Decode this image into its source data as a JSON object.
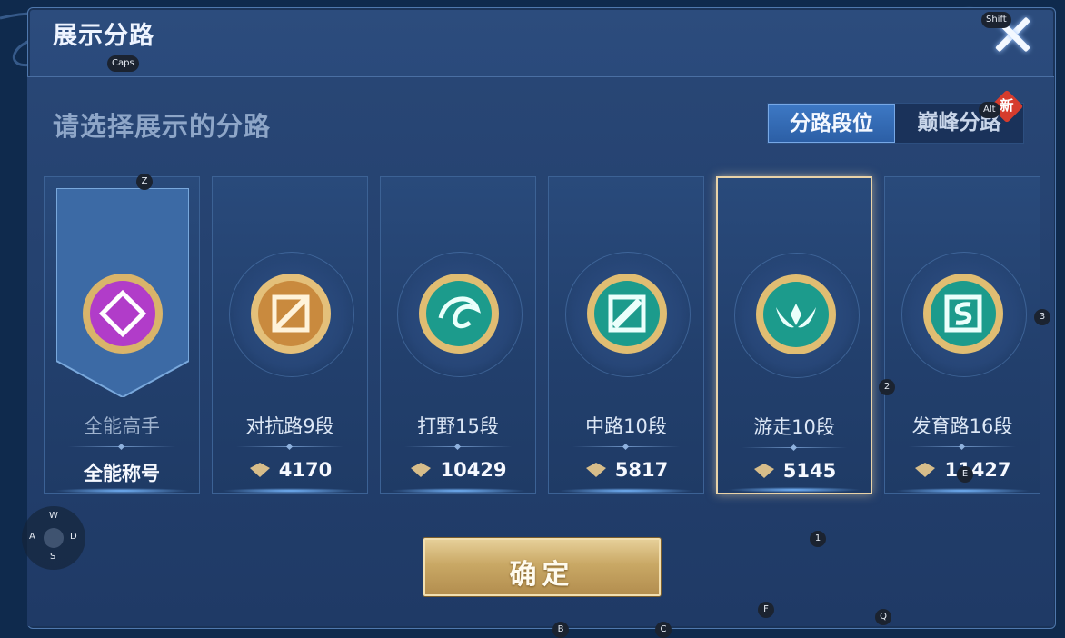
{
  "dialog": {
    "title": "展示分路",
    "subtitle": "请选择展示的分路",
    "close_icon": "close-x-icon"
  },
  "mode_toggle": {
    "active_label": "分路段位",
    "inactive_label": "巅峰分路",
    "new_badge": "新"
  },
  "lanes": [
    {
      "label": "全能高手",
      "value": "全能称号",
      "medal_color": "#b13cc9",
      "selected": false,
      "icon": "all-round-medal-icon"
    },
    {
      "label": "对抗路9段",
      "value": "4170",
      "medal_color": "#c98a3e",
      "selected": false,
      "icon": "sword-medal-icon"
    },
    {
      "label": "打野15段",
      "value": "10429",
      "medal_color": "#1c9b8c",
      "selected": false,
      "icon": "dragon-medal-icon"
    },
    {
      "label": "中路10段",
      "value": "5817",
      "medal_color": "#1c9b8c",
      "selected": false,
      "icon": "staff-medal-icon"
    },
    {
      "label": "游走10段",
      "value": "5145",
      "medal_color": "#1c9b8c",
      "selected": true,
      "icon": "wings-medal-icon"
    },
    {
      "label": "发育路16段",
      "value": "11427",
      "medal_color": "#1c9b8c",
      "selected": false,
      "icon": "arrow-medal-icon"
    }
  ],
  "confirm_button": "确定",
  "key_hints": {
    "shift": "Shift",
    "caps": "Caps",
    "alt": "Alt",
    "z": "Z",
    "num3": "3",
    "num2": "2",
    "num1": "1",
    "e": "E",
    "b": "B",
    "c": "C",
    "f": "F",
    "q": "Q",
    "w": "W",
    "a": "A",
    "s": "S",
    "d": "D"
  },
  "colors": {
    "accent": "#3d78c4",
    "gold": "#c9a865",
    "selected_border": "#e9d3a8"
  }
}
